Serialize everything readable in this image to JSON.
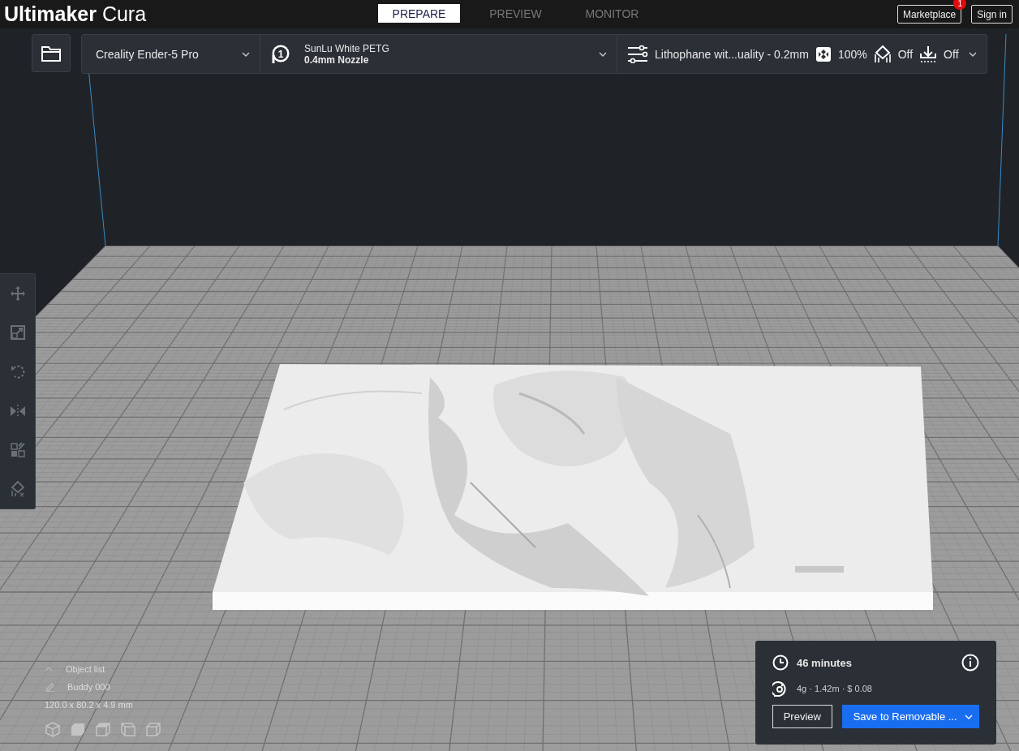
{
  "app": {
    "title": "**Ultimaker** Cura"
  },
  "tabs": [
    {
      "label": "PREPARE",
      "selected": true
    },
    {
      "label": "PREVIEW",
      "selected": false
    },
    {
      "label": "MONITOR",
      "selected": false
    }
  ],
  "header_buttons": [
    {
      "label": "Marketplace",
      "badge": "1"
    },
    {
      "label": "Sign in"
    }
  ],
  "printer": {
    "name": "Creality Ender-5 Pro"
  },
  "material": {
    "extruder": "1",
    "name": "SunLu White PETG",
    "nozzle": "0.4mm Nozzle"
  },
  "print_settings": {
    "profile": "Lithophane wit...uality - 0.2mm",
    "infill": "100%",
    "support": "Off",
    "adhesion": "Off"
  },
  "tools": [
    {
      "kind": "move"
    },
    {
      "kind": "scale"
    },
    {
      "kind": "rotate"
    },
    {
      "kind": "mirror"
    },
    {
      "kind": "per-model"
    },
    {
      "kind": "support-blocker"
    }
  ],
  "object_list": {
    "title": "Object list",
    "object": "Buddy 000",
    "dimensions": "120.0 x 80.2 x 4.9 mm"
  },
  "view_buttons": [
    {
      "kind": "perspective"
    },
    {
      "kind": "front"
    },
    {
      "kind": "top"
    },
    {
      "kind": "left"
    },
    {
      "kind": "right"
    }
  ],
  "print_summary": {
    "time": "46 minutes",
    "material": "4g · 1.42m · $ 0.08",
    "preview_button": "Preview",
    "save_button": "Save to Removable ..."
  }
}
